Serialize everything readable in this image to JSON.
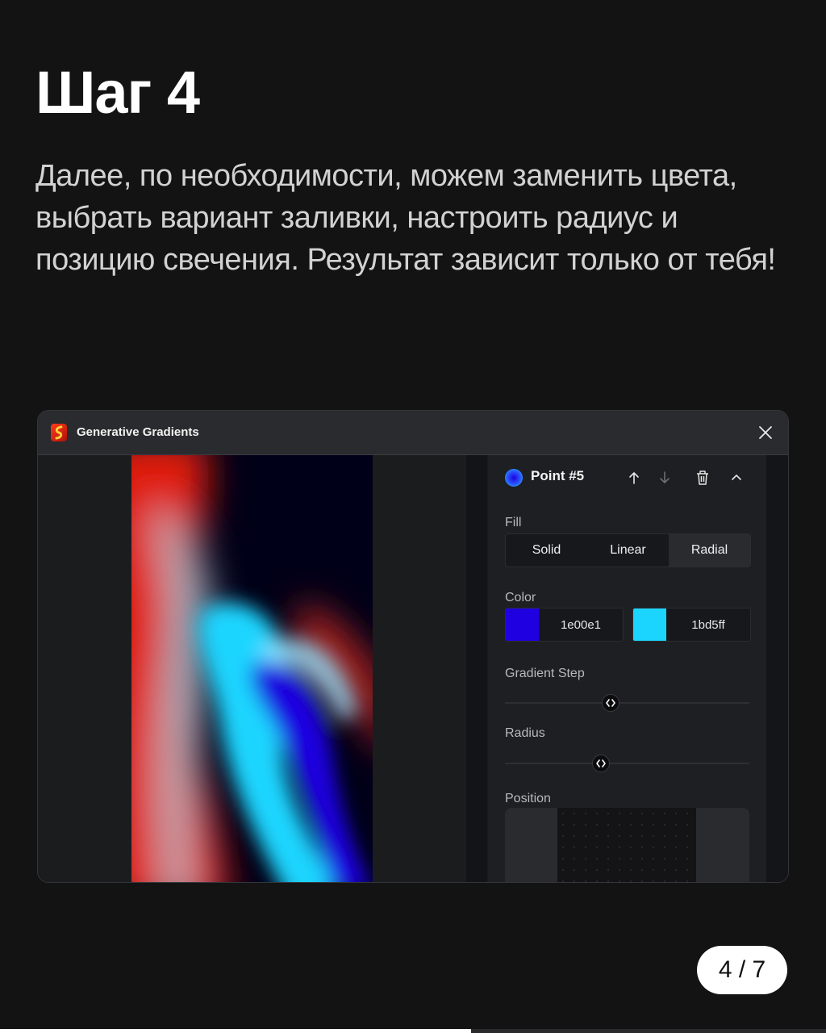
{
  "heading": "Шаг 4",
  "description": "Далее, по необходимости, можем заменить цвета, выбрать вариант заливки, настроить радиус и позицию свечения. Результат зависит только от тебя!",
  "window": {
    "title": "Generative Gradients",
    "logo_icon": "plugin-logo-icon",
    "close_icon": "close-icon"
  },
  "panel": {
    "point_label": "Point #5",
    "point_color": "#1e00e1",
    "icons": [
      "arrow-up-icon",
      "arrow-down-icon",
      "trash-icon",
      "chevron-up-icon"
    ],
    "fill_label": "Fill",
    "fill_options": [
      "Solid",
      "Linear",
      "Radial"
    ],
    "fill_selected": "Radial",
    "color_label": "Color",
    "colors": [
      {
        "hex": "1e00e1",
        "swatch": "#1e00e1"
      },
      {
        "hex": "1bd5ff",
        "swatch": "#1bd5ff"
      }
    ],
    "gradient_step_label": "Gradient Step",
    "gradient_step_value": 0.43,
    "radius_label": "Radius",
    "radius_value": 0.39,
    "position_label": "Position"
  },
  "pagination": {
    "label": "4 / 7",
    "progress": 0.57
  },
  "colors": {
    "background": "#131314",
    "preview_red": "#e01a0a",
    "preview_blue": "#1e00e1",
    "preview_cyan": "#1bd5ff",
    "preview_dark": "#000018"
  }
}
